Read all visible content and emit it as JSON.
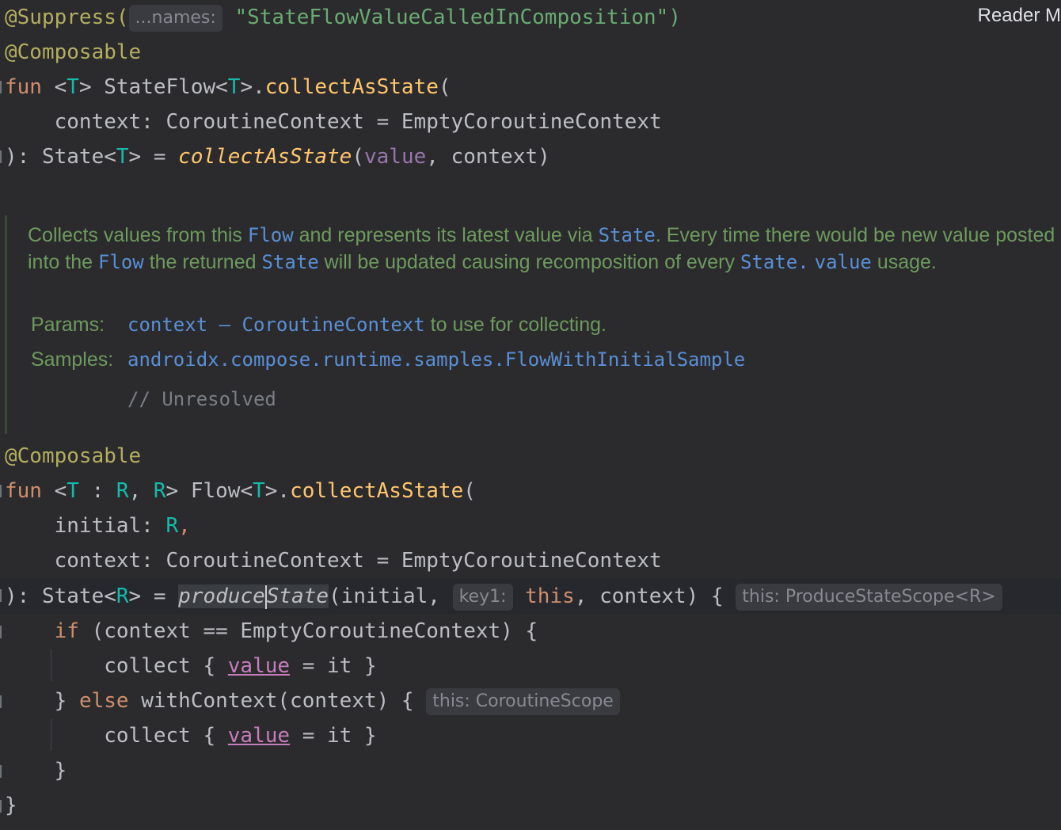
{
  "top_right_label": "Reader M",
  "block1": {
    "suppress_ann": "@Suppress(",
    "suppress_hint": "...names:",
    "suppress_str": "\"StateFlowValueCalledInComposition\")",
    "composable": "@Composable",
    "l3_fun": "fun",
    "l3_lt": " <",
    "l3_t": "T",
    "l3_mid": "> StateFlow<",
    "l3_t2": "T",
    "l3_dot": ">.",
    "l3_name": "collectAsState",
    "l3_open": "(",
    "l4": "    context: CoroutineContext = EmptyCoroutineContext",
    "l5_a": "): State<",
    "l5_t": "T",
    "l5_b": "> = ",
    "l5_call": "collectAsState",
    "l5_c": "(",
    "l5_value": "value",
    "l5_d": ", context)"
  },
  "doc": {
    "p1_a": "Collects values from this ",
    "p1_flow": "Flow",
    "p1_b": " and represents its latest value via ",
    "p1_state": "State",
    "p1_c": ". Every time there would be new value posted into the ",
    "p1_flow2": "Flow",
    "p1_d": " the returned ",
    "p1_state2": "State",
    "p1_e": " will be updated causing recomposition of every ",
    "p1_state3": "State.",
    "p1_value": "value",
    "p1_f": " usage.",
    "params_label": "Params:",
    "params_code1": "context",
    "params_dash": " – ",
    "params_code2": "CoroutineContext",
    "params_text": " to use for collecting.",
    "samples_label": "Samples:",
    "samples_link": "androidx.compose.runtime.samples.FlowWithInitialSample",
    "unresolved": "// Unresolved"
  },
  "block2": {
    "composable": "@Composable",
    "l2_fun": "fun",
    "l2_a": " <",
    "l2_t": "T",
    "l2_b": " : ",
    "l2_r": "R",
    "l2_c": ", ",
    "l2_r2": "R",
    "l2_d": "> Flow<",
    "l2_t2": "T",
    "l2_e": ">.",
    "l2_name": "collectAsState",
    "l2_f": "(",
    "l3_a": "    initial: ",
    "l3_r": "R",
    "l3_b": ",",
    "l4": "    context: CoroutineContext = EmptyCoroutineContext",
    "l5_a": "): State<",
    "l5_r": "R",
    "l5_b": "> = ",
    "l5_call1": "produce",
    "l5_call2": "State",
    "l5_c": "(initial, ",
    "l5_hint_key": "key1:",
    "l5_this": "this",
    "l5_d": ", context) {",
    "l5_hint_scope": "this: ProduceStateScope<R>",
    "l6_if": "if",
    "l6_rest": " (context == EmptyCoroutineContext) {",
    "l7_a": "collect { ",
    "l7_value": "value",
    "l7_b": " = it }",
    "l8_a": "} ",
    "l8_else": "else",
    "l8_b": " withContext(context) {",
    "l8_hint": "this: CoroutineScope",
    "l9_a": "collect { ",
    "l9_value": "value",
    "l9_b": " = it }",
    "l10": "}",
    "l11": "}"
  },
  "colors": {
    "background": "#2b2b2d",
    "annotation": "#b3ae60",
    "keyword": "#cf8e6d",
    "type_param": "#16baac",
    "function": "#ffc66d",
    "string": "#6aab73",
    "doc_text": "#6e9a5e",
    "doc_code": "#5a8fd6"
  }
}
